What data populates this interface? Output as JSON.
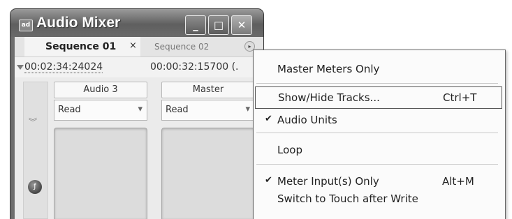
{
  "window": {
    "title": "Audio Mixer",
    "app_icon_text": "ad",
    "minimize_glyph": "_",
    "maximize_glyph": "□",
    "close_glyph": "✕"
  },
  "tabs": [
    {
      "label": "Sequence 01",
      "close_glyph": "×"
    },
    {
      "label": "Sequence 02"
    }
  ],
  "tab_menu_glyph": "▸",
  "timecodes": [
    "00:02:34:24024",
    "00:00:32:15700 (."
  ],
  "leftbar": {
    "chevron_glyph": "︾",
    "knob_glyph": "ƒ"
  },
  "tracks": [
    {
      "name": "Audio 3",
      "automation": "Read",
      "dropdown_glyph": "▾"
    },
    {
      "name": "Master",
      "automation": "Read",
      "dropdown_glyph": "▾"
    }
  ],
  "menu": {
    "items": [
      {
        "label": "Master Meters Only",
        "shortcut": "",
        "checked": false
      },
      {
        "label": "Show/Hide Tracks...",
        "shortcut": "Ctrl+T",
        "checked": false,
        "highlighted": true
      },
      {
        "label": "Audio Units",
        "shortcut": "",
        "checked": true
      },
      {
        "label": "Loop",
        "shortcut": "",
        "checked": false
      },
      {
        "label": "Meter Input(s) Only",
        "shortcut": "Alt+M",
        "checked": true
      },
      {
        "label": "Switch to Touch after Write",
        "shortcut": "",
        "checked": false
      }
    ],
    "check_glyph": "✔"
  }
}
